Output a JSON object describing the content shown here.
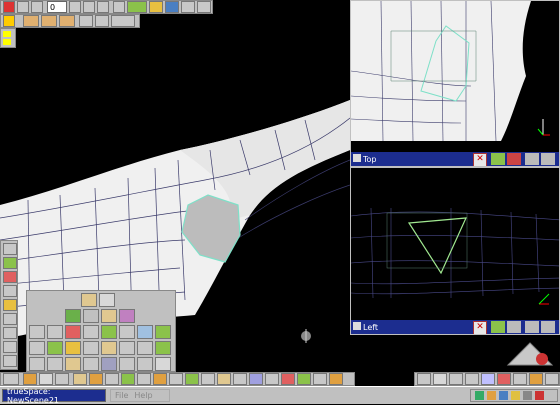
{
  "app": {
    "title": "trueSpace: NewScene21"
  },
  "toolbar": {
    "frame_value": "0"
  },
  "views": {
    "top": {
      "label": "Top"
    },
    "left": {
      "label": "Left"
    }
  },
  "menu": {
    "file": "File",
    "help": "Help"
  },
  "colors": {
    "title_blue": "#1c2d8f",
    "panel_gray": "#c0c0c0",
    "wire": "#5a5a9a",
    "selection": "#7ee0c8"
  }
}
